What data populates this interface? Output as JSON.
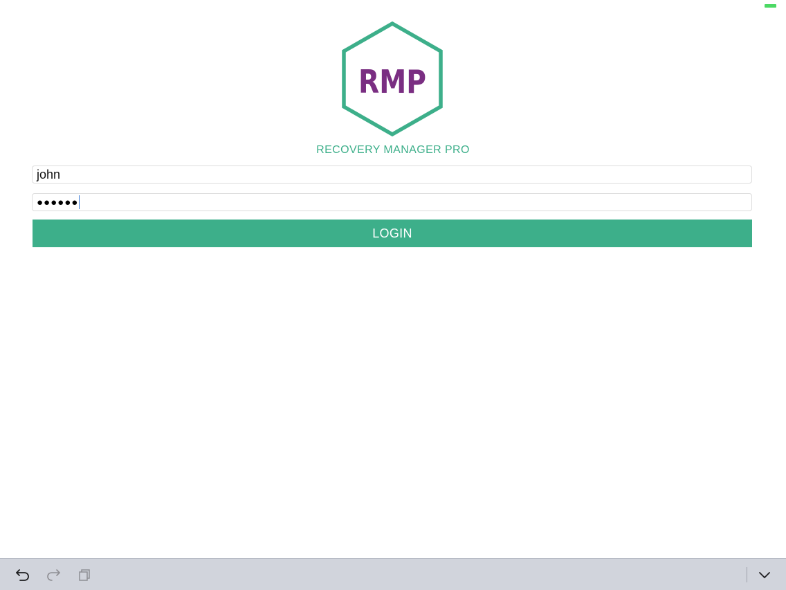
{
  "status_bar": {
    "battery_color": "#4cd964"
  },
  "logo": {
    "text": "RMP",
    "hex_color": "#3daf8a",
    "text_color": "#7a2e82"
  },
  "app": {
    "name": "RECOVERY MANAGER PRO",
    "name_color": "#3daf8a"
  },
  "login_form": {
    "username_value": "john",
    "password_value": "●●●●●●",
    "login_label": "LOGIN",
    "button_color": "#3daf8a"
  },
  "keyboard_toolbar": {
    "icons": [
      "undo-icon",
      "redo-icon",
      "paste-icon",
      "dismiss-keyboard-icon"
    ]
  }
}
